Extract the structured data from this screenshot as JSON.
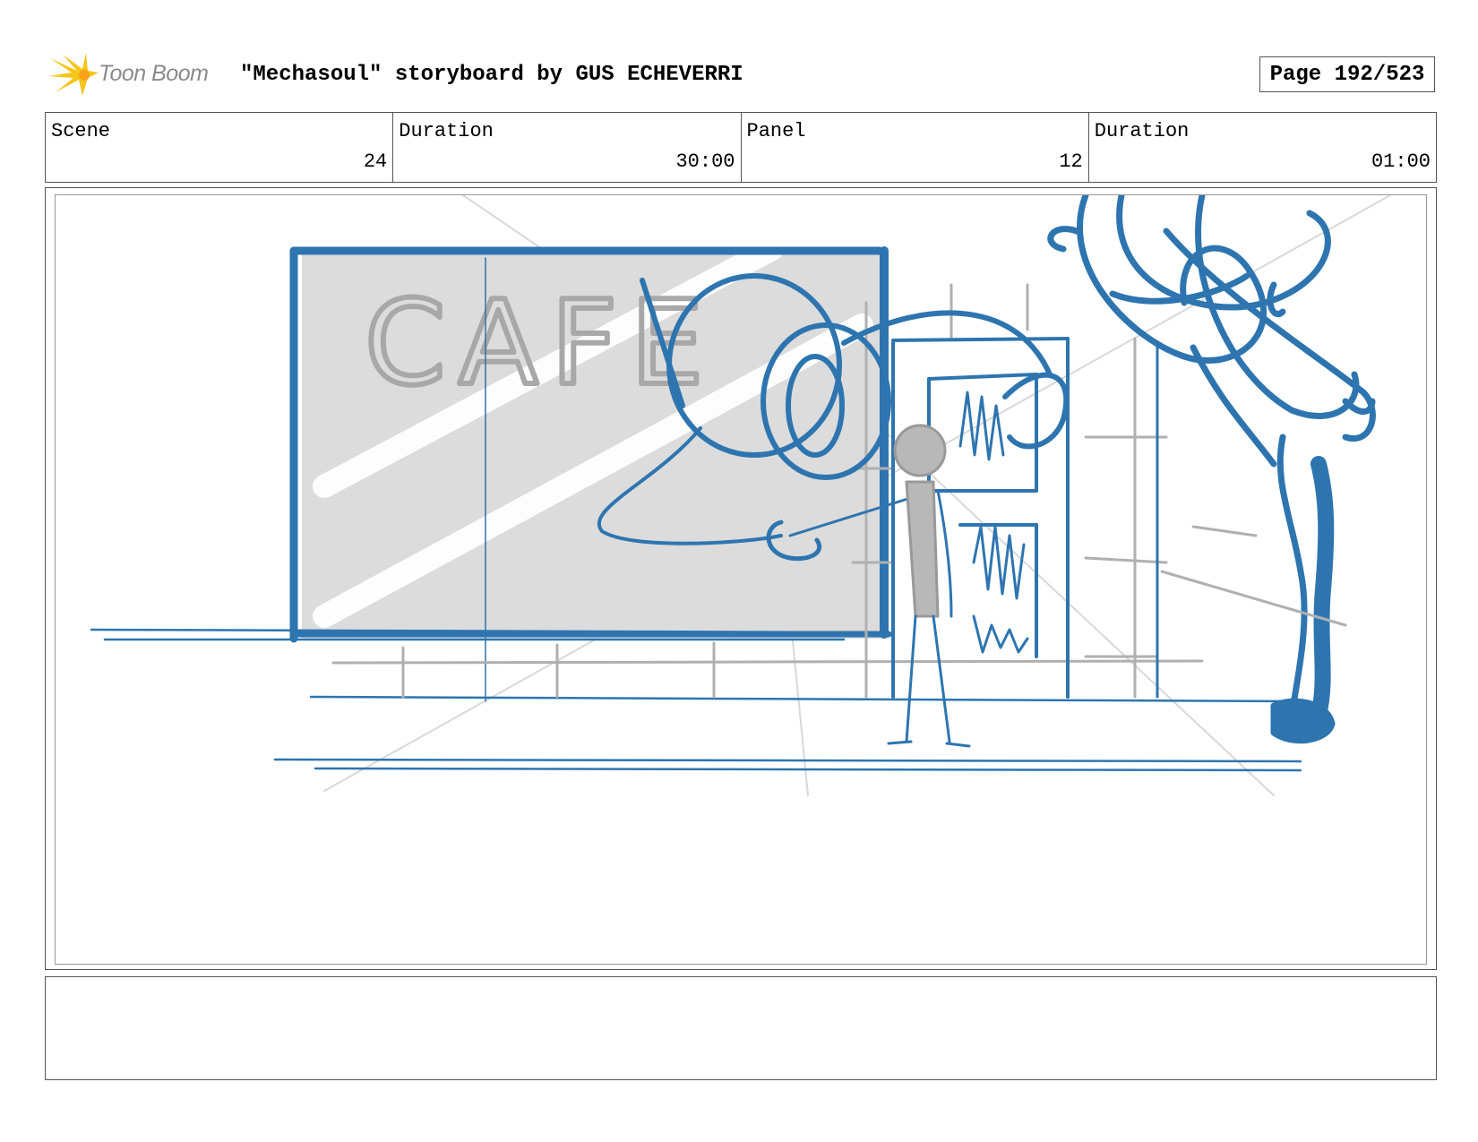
{
  "header": {
    "logo_text": "Toon Boom",
    "title": "\"Mechasoul\" storyboard by GUS ECHEVERRI",
    "page_label": "Page 192/523"
  },
  "info": [
    {
      "label": "Scene",
      "value": "24"
    },
    {
      "label": "Duration",
      "value": "30:00"
    },
    {
      "label": "Panel",
      "value": "12"
    },
    {
      "label": "Duration",
      "value": "01:00"
    }
  ],
  "panel": {
    "sign_text": "CAFE",
    "colors": {
      "ink_blue": "#2e75b0",
      "sketch_gray": "#aaaaaa",
      "window_fill": "#dcdcdc"
    }
  },
  "notes": {
    "text": ""
  }
}
